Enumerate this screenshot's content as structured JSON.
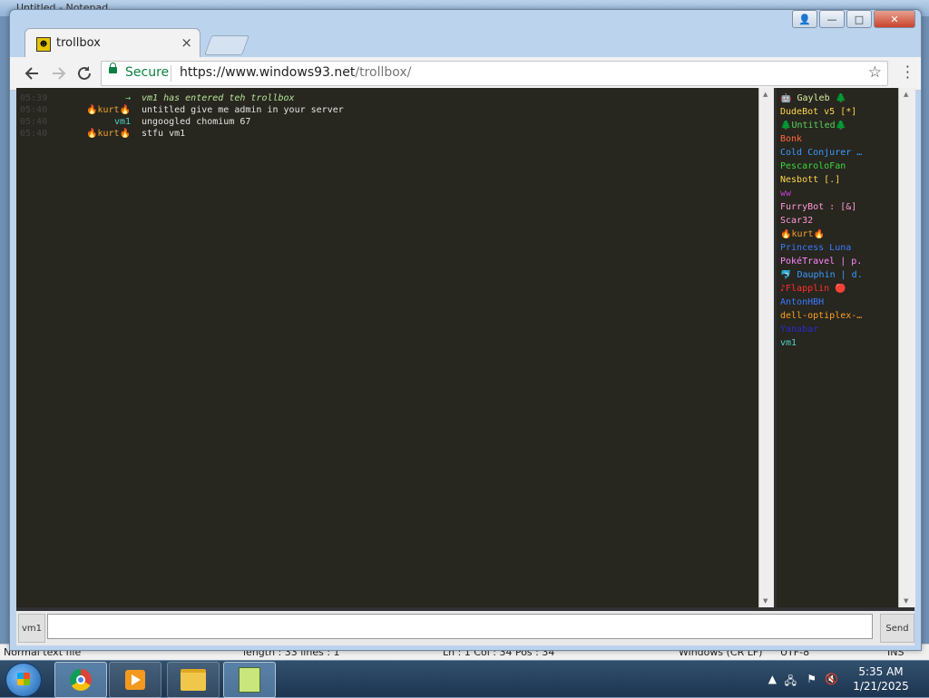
{
  "background_window": {
    "title": "Untitled - Notepad",
    "status": {
      "mode": "Normal text file",
      "length": "length : 33    lines : 1",
      "position": "Ln : 1    Col : 34    Pos : 34",
      "eol": "Windows (CR LF)",
      "encoding": "UTF-8",
      "ins": "INS"
    }
  },
  "browser": {
    "tab_title": "trollbox",
    "tab_close": "×",
    "secure_label": "Secure",
    "url_host": "https://www.windows93.net",
    "url_path": "/trollbox/",
    "star": "☆",
    "window_buttons": {
      "user": "👤",
      "minimize": "—",
      "maximize": "□",
      "close": "✕"
    }
  },
  "chat": {
    "messages": [
      {
        "time": "05:39",
        "nick": "→",
        "nick_color": "#7fd67f",
        "text": "vm1 has entered teh trollbox",
        "system": true
      },
      {
        "time": "05:40",
        "nick": "🔥kurt🔥",
        "nick_color": "#f0a030",
        "text": "untitled give me admin in your server",
        "system": false
      },
      {
        "time": "05:40",
        "nick": "vm1",
        "nick_color": "#4fd1c5",
        "text": "ungoogled chomium 67",
        "system": false
      },
      {
        "time": "05:40",
        "nick": "🔥kurt🔥",
        "nick_color": "#f0a030",
        "text": "stfu vm1",
        "system": false
      }
    ]
  },
  "users": [
    {
      "name": "🤖 Gayleb 🌲",
      "color": "#d8f0a0"
    },
    {
      "name": "DudeBot v5 [*]",
      "color": "#ffd84a"
    },
    {
      "name": "🌲Untitled🌲",
      "color": "#5bd15b"
    },
    {
      "name": "Bonk",
      "color": "#ff6a3d"
    },
    {
      "name": "Cold Conjurer …",
      "color": "#3a9bff"
    },
    {
      "name": "PescaroloFan",
      "color": "#3ed63e"
    },
    {
      "name": "Nesbott [.]",
      "color": "#ffd84a"
    },
    {
      "name": "ww",
      "color": "#c040d0"
    },
    {
      "name": "FurryBot : [&]",
      "color": "#ff9ad6"
    },
    {
      "name": "Scar32",
      "color": "#ff9ad6"
    },
    {
      "name": "🔥kurt🔥",
      "color": "#f0a030"
    },
    {
      "name": "Princess Luna",
      "color": "#3a7bff"
    },
    {
      "name": "PokéTravel | p.",
      "color": "#ff88ff"
    },
    {
      "name": "🐬 Dauphin | d.",
      "color": "#3a9bff"
    },
    {
      "name": "♪Flapplin 🔴",
      "color": "#ff3030"
    },
    {
      "name": "AntonHBH",
      "color": "#3a7bff"
    },
    {
      "name": "dell-optiplex-…",
      "color": "#ffa020"
    },
    {
      "name": "Yanabar",
      "color": "#2a2acc"
    },
    {
      "name": "vm1",
      "color": "#4fd1c5"
    }
  ],
  "input": {
    "nick_label": "vm1",
    "value": "",
    "send_label": "Send"
  },
  "taskbar": {
    "time": "5:35 AM",
    "date": "1/21/2025"
  }
}
